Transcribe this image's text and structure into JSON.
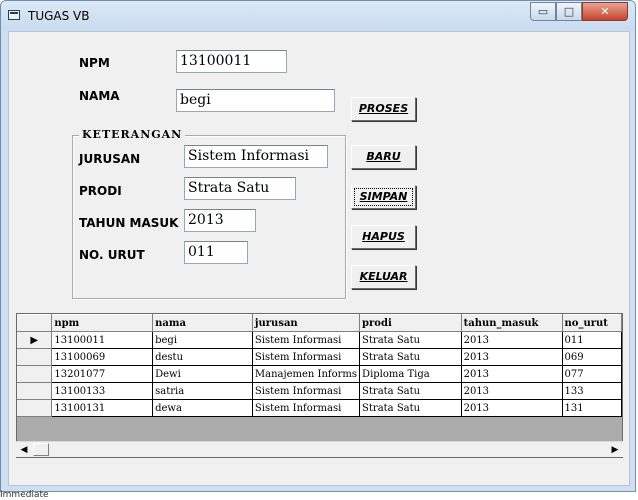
{
  "window": {
    "title": "TUGAS VB",
    "minimize_glyph": "▭",
    "maximize_glyph": "□",
    "close_glyph": "✕"
  },
  "form": {
    "npm_label": "NPM",
    "npm_value": "13100011",
    "nama_label": "NAMA",
    "nama_value": "begi",
    "frame_caption": "KETERANGAN",
    "jurusan_label": "JURUSAN",
    "jurusan_value": "Sistem Informasi",
    "prodi_label": "PRODI",
    "prodi_value": "Strata Satu",
    "tahun_label": "TAHUN MASUK",
    "tahun_value": "2013",
    "urut_label": "NO. URUT",
    "urut_value": "011"
  },
  "buttons": {
    "proses": "PROSES",
    "baru": "BARU",
    "simpan": "SIMPAN",
    "hapus": "HAPUS",
    "keluar": "KELUAR"
  },
  "grid": {
    "columns": [
      "npm",
      "nama",
      "jurusan",
      "prodi",
      "tahun_masuk",
      "no_urut"
    ],
    "current_row_marker": "▶",
    "rows": [
      [
        "13100011",
        "begi",
        "Sistem Informasi",
        "Strata Satu",
        "2013",
        "011"
      ],
      [
        "13100069",
        "destu",
        "Sistem Informasi",
        "Strata Satu",
        "2013",
        "069"
      ],
      [
        "13201077",
        "Dewi",
        "Manajemen Informs",
        "Diploma Tiga",
        "2013",
        "077"
      ],
      [
        "13100133",
        "satria",
        "Sistem Informasi",
        "Strata Satu",
        "2013",
        "133"
      ],
      [
        "13100131",
        "dewa",
        "Sistem Informasi",
        "Strata Satu",
        "2013",
        "131"
      ]
    ],
    "scroll_left_glyph": "◀",
    "scroll_right_glyph": "▶"
  },
  "status": {
    "text": "Immediate"
  }
}
